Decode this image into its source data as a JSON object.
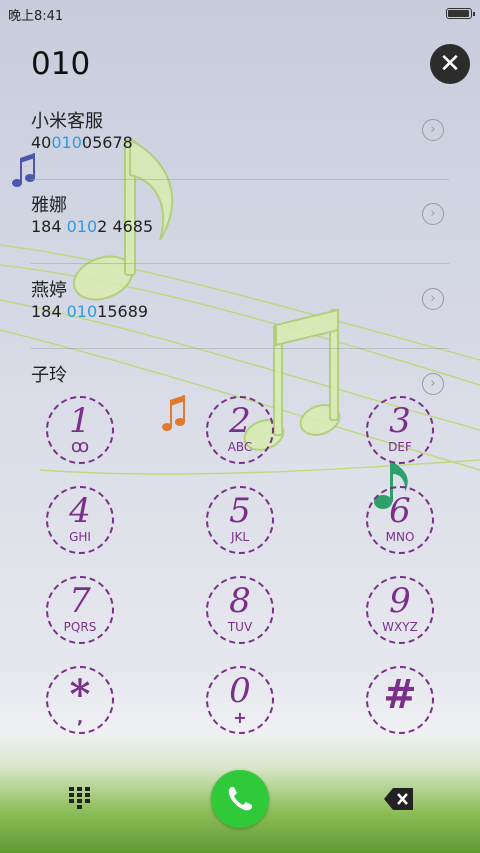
{
  "status_bar": {
    "time": "晚上8:41",
    "battery_level": 0.95
  },
  "dialer": {
    "input_value": "010"
  },
  "contacts": [
    {
      "name": "小米客服",
      "number_parts": [
        "40",
        "010",
        "05678"
      ]
    },
    {
      "name": "雅娜",
      "number_parts": [
        "184 ",
        "010",
        "2 4685"
      ]
    },
    {
      "name": "燕婷",
      "number_parts": [
        "184 ",
        "010",
        "15689"
      ]
    },
    {
      "name": "子玲",
      "number_parts": [
        "",
        "",
        ""
      ]
    }
  ],
  "keypad": [
    {
      "digit": "1",
      "letters": "ꝏ",
      "icon": "voicemail-icon"
    },
    {
      "digit": "2",
      "letters": "ABC"
    },
    {
      "digit": "3",
      "letters": "DEF"
    },
    {
      "digit": "4",
      "letters": "GHI"
    },
    {
      "digit": "5",
      "letters": "JKL"
    },
    {
      "digit": "6",
      "letters": "MNO"
    },
    {
      "digit": "7",
      "letters": "PQRS"
    },
    {
      "digit": "8",
      "letters": "TUV"
    },
    {
      "digit": "9",
      "letters": "WXYZ"
    },
    {
      "digit": "*",
      "letters": ","
    },
    {
      "digit": "0",
      "letters": "+"
    },
    {
      "digit": "#",
      "letters": ""
    }
  ],
  "bottom_bar": {
    "left_icon": "keypad-grid-icon",
    "center_icon": "phone-call-icon",
    "right_icon": "backspace-icon"
  },
  "colors": {
    "highlight": "#2d9be0",
    "key_accent": "#7a2f8a",
    "call_green": "#2fc93a"
  }
}
